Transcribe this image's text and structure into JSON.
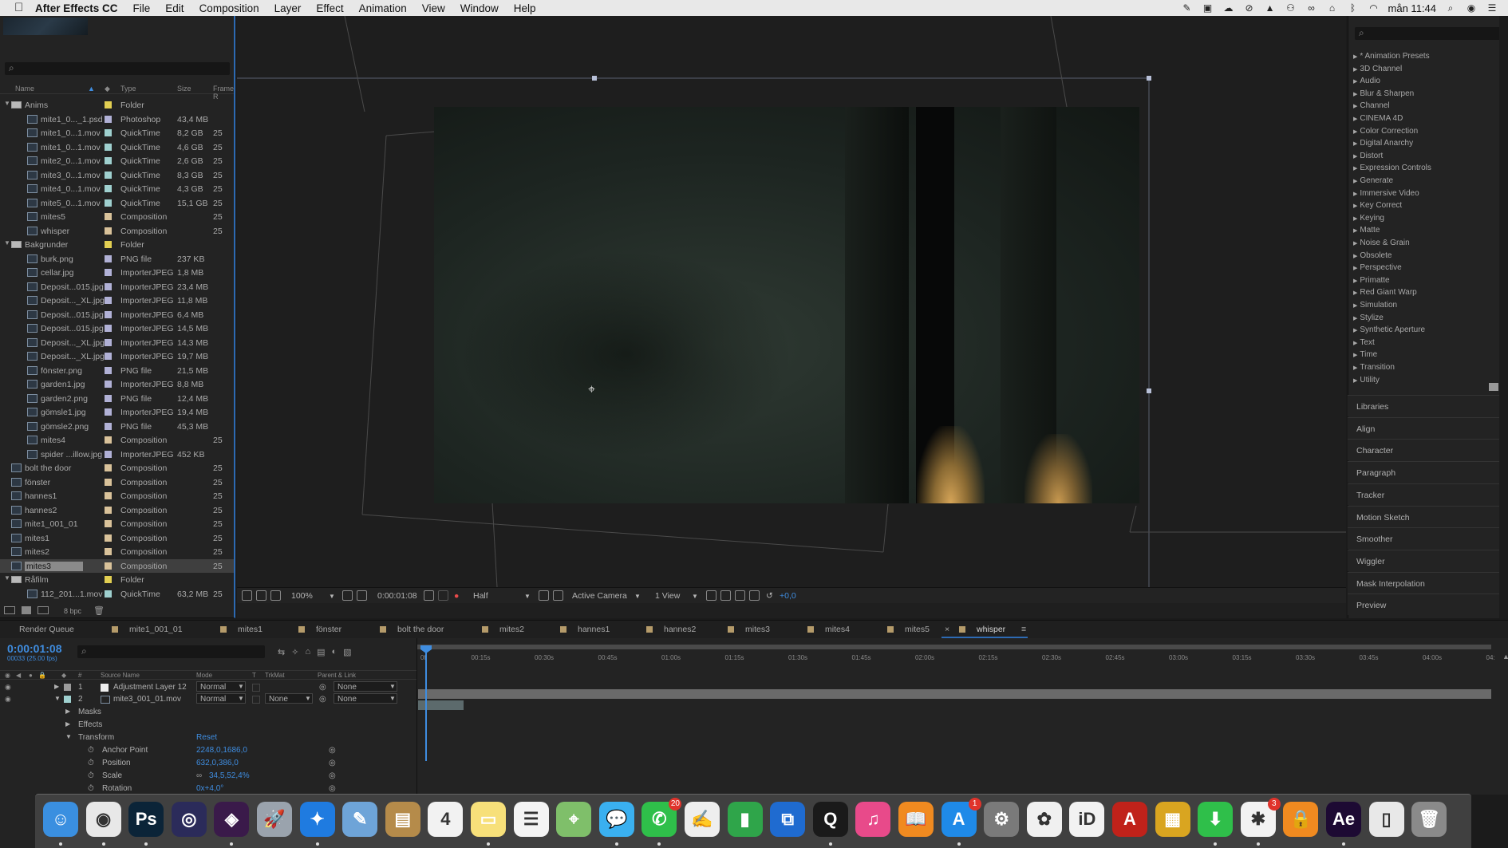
{
  "menubar": {
    "apple": "",
    "items": [
      "After Effects CC",
      "File",
      "Edit",
      "Composition",
      "Layer",
      "Effect",
      "Animation",
      "View",
      "Window",
      "Help"
    ],
    "clock": "mån 11:44"
  },
  "project": {
    "columns": {
      "name": "Name",
      "type": "Type",
      "size": "Size",
      "frame": "Frame R"
    },
    "rows": [
      {
        "indent": 0,
        "twirl": "▼",
        "name": "Anims",
        "type": "Folder",
        "size": "",
        "frame": "",
        "color": "#e2cf52",
        "kind": "folder"
      },
      {
        "indent": 1,
        "name": "mite1_0..._1.psd",
        "type": "Photoshop",
        "size": "43,4 MB",
        "frame": "",
        "color": "#b1b1d6",
        "kind": "file"
      },
      {
        "indent": 1,
        "name": "mite1_0...1.mov",
        "type": "QuickTime",
        "size": "8,2 GB",
        "frame": "25",
        "color": "#9fd0cf",
        "kind": "file"
      },
      {
        "indent": 1,
        "name": "mite1_0...1.mov",
        "type": "QuickTime",
        "size": "4,6 GB",
        "frame": "25",
        "color": "#9fd0cf",
        "kind": "file"
      },
      {
        "indent": 1,
        "name": "mite2_0...1.mov",
        "type": "QuickTime",
        "size": "2,6 GB",
        "frame": "25",
        "color": "#9fd0cf",
        "kind": "file"
      },
      {
        "indent": 1,
        "name": "mite3_0...1.mov",
        "type": "QuickTime",
        "size": "8,3 GB",
        "frame": "25",
        "color": "#9fd0cf",
        "kind": "file"
      },
      {
        "indent": 1,
        "name": "mite4_0...1.mov",
        "type": "QuickTime",
        "size": "4,3 GB",
        "frame": "25",
        "color": "#9fd0cf",
        "kind": "file"
      },
      {
        "indent": 1,
        "name": "mite5_0...1.mov",
        "type": "QuickTime",
        "size": "15,1 GB",
        "frame": "25",
        "color": "#9fd0cf",
        "kind": "file"
      },
      {
        "indent": 1,
        "name": "mites5",
        "type": "Composition",
        "size": "",
        "frame": "25",
        "color": "#d9c29a",
        "kind": "comp"
      },
      {
        "indent": 1,
        "name": "whisper",
        "type": "Composition",
        "size": "",
        "frame": "25",
        "color": "#d9c29a",
        "kind": "comp"
      },
      {
        "indent": 0,
        "twirl": "▼",
        "name": "Bakgrunder",
        "type": "Folder",
        "size": "",
        "frame": "",
        "color": "#e2cf52",
        "kind": "folder"
      },
      {
        "indent": 1,
        "name": "burk.png",
        "type": "PNG file",
        "size": "237 KB",
        "frame": "",
        "color": "#b1b1d6",
        "kind": "file"
      },
      {
        "indent": 1,
        "name": "cellar.jpg",
        "type": "ImporterJPEG",
        "size": "1,8 MB",
        "frame": "",
        "color": "#b1b1d6",
        "kind": "file"
      },
      {
        "indent": 1,
        "name": "Deposit...015.jpg",
        "type": "ImporterJPEG",
        "size": "23,4 MB",
        "frame": "",
        "color": "#b1b1d6",
        "kind": "file"
      },
      {
        "indent": 1,
        "name": "Deposit..._XL.jpg",
        "type": "ImporterJPEG",
        "size": "11,8 MB",
        "frame": "",
        "color": "#b1b1d6",
        "kind": "file"
      },
      {
        "indent": 1,
        "name": "Deposit...015.jpg",
        "type": "ImporterJPEG",
        "size": "6,4 MB",
        "frame": "",
        "color": "#b1b1d6",
        "kind": "file"
      },
      {
        "indent": 1,
        "name": "Deposit...015.jpg",
        "type": "ImporterJPEG",
        "size": "14,5 MB",
        "frame": "",
        "color": "#b1b1d6",
        "kind": "file"
      },
      {
        "indent": 1,
        "name": "Deposit..._XL.jpg",
        "type": "ImporterJPEG",
        "size": "14,3 MB",
        "frame": "",
        "color": "#b1b1d6",
        "kind": "file"
      },
      {
        "indent": 1,
        "name": "Deposit..._XL.jpg",
        "type": "ImporterJPEG",
        "size": "19,7 MB",
        "frame": "",
        "color": "#b1b1d6",
        "kind": "file"
      },
      {
        "indent": 1,
        "name": "fönster.png",
        "type": "PNG file",
        "size": "21,5 MB",
        "frame": "",
        "color": "#b1b1d6",
        "kind": "file"
      },
      {
        "indent": 1,
        "name": "garden1.jpg",
        "type": "ImporterJPEG",
        "size": "8,8 MB",
        "frame": "",
        "color": "#b1b1d6",
        "kind": "file"
      },
      {
        "indent": 1,
        "name": "garden2.png",
        "type": "PNG file",
        "size": "12,4 MB",
        "frame": "",
        "color": "#b1b1d6",
        "kind": "file"
      },
      {
        "indent": 1,
        "name": "gömsle1.jpg",
        "type": "ImporterJPEG",
        "size": "19,4 MB",
        "frame": "",
        "color": "#b1b1d6",
        "kind": "file"
      },
      {
        "indent": 1,
        "name": "gömsle2.png",
        "type": "PNG file",
        "size": "45,3 MB",
        "frame": "",
        "color": "#b1b1d6",
        "kind": "file"
      },
      {
        "indent": 1,
        "name": "mites4",
        "type": "Composition",
        "size": "",
        "frame": "25",
        "color": "#d9c29a",
        "kind": "comp"
      },
      {
        "indent": 1,
        "name": "spider ...illow.jpg",
        "type": "ImporterJPEG",
        "size": "452 KB",
        "frame": "",
        "color": "#b1b1d6",
        "kind": "file"
      },
      {
        "indent": 0,
        "name": "bolt the door",
        "type": "Composition",
        "size": "",
        "frame": "25",
        "color": "#d9c29a",
        "kind": "comp"
      },
      {
        "indent": 0,
        "name": "fönster",
        "type": "Composition",
        "size": "",
        "frame": "25",
        "color": "#d9c29a",
        "kind": "comp"
      },
      {
        "indent": 0,
        "name": "hannes1",
        "type": "Composition",
        "size": "",
        "frame": "25",
        "color": "#d9c29a",
        "kind": "comp"
      },
      {
        "indent": 0,
        "name": "hannes2",
        "type": "Composition",
        "size": "",
        "frame": "25",
        "color": "#d9c29a",
        "kind": "comp"
      },
      {
        "indent": 0,
        "name": "mite1_001_01",
        "type": "Composition",
        "size": "",
        "frame": "25",
        "color": "#d9c29a",
        "kind": "comp"
      },
      {
        "indent": 0,
        "name": "mites1",
        "type": "Composition",
        "size": "",
        "frame": "25",
        "color": "#d9c29a",
        "kind": "comp"
      },
      {
        "indent": 0,
        "name": "mites2",
        "type": "Composition",
        "size": "",
        "frame": "25",
        "color": "#d9c29a",
        "kind": "comp"
      },
      {
        "indent": 0,
        "name": "mites3",
        "type": "Composition",
        "size": "",
        "frame": "25",
        "color": "#d9c29a",
        "kind": "comp",
        "selected": true
      },
      {
        "indent": 0,
        "twirl": "▼",
        "name": "Råfilm",
        "type": "Folder",
        "size": "",
        "frame": "",
        "color": "#e2cf52",
        "kind": "folder"
      },
      {
        "indent": 1,
        "name": "112_201...1.mov",
        "type": "QuickTime",
        "size": "63,2 MB",
        "frame": "25",
        "color": "#9fd0cf",
        "kind": "file"
      }
    ],
    "footer_bpc": "8 bpc"
  },
  "viewer": {
    "zoom": "100%",
    "timecode": "0:00:01:08",
    "resolution": "Half",
    "camera": "Active Camera",
    "views": "1 View",
    "exposure": "+0,0"
  },
  "effects": {
    "categories": [
      "* Animation Presets",
      "3D Channel",
      "Audio",
      "Blur & Sharpen",
      "Channel",
      "CINEMA 4D",
      "Color Correction",
      "Digital Anarchy",
      "Distort",
      "Expression Controls",
      "Generate",
      "Immersive Video",
      "Key Correct",
      "Keying",
      "Matte",
      "Noise & Grain",
      "Obsolete",
      "Perspective",
      "Primatte",
      "Red Giant Warp",
      "Simulation",
      "Stylize",
      "Synthetic Aperture",
      "Text",
      "Time",
      "Transition",
      "Utility"
    ],
    "panels": [
      "Libraries",
      "Align",
      "Character",
      "Paragraph",
      "Tracker",
      "Motion Sketch",
      "Smoother",
      "Wiggler",
      "Mask Interpolation",
      "Preview"
    ]
  },
  "timeline": {
    "tabs": [
      "Render Queue",
      "mite1_001_01",
      "mites1",
      "fönster",
      "bolt the door",
      "mites2",
      "hannes1",
      "hannes2",
      "mites3",
      "mites4",
      "mites5",
      "whisper"
    ],
    "active_tab": "whisper",
    "current_time": "0:00:01:08",
    "fps": "00033 (25.00 fps)",
    "columns": {
      "num": "#",
      "source": "Source Name",
      "mode": "Mode",
      "t": "T",
      "trkmat": "TrkMat",
      "parent": "Parent & Link"
    },
    "layers": [
      {
        "num": "1",
        "name": "Adjustment Layer 12",
        "mode": "Normal",
        "trkmat": "",
        "parent": "None"
      },
      {
        "num": "2",
        "name": "mite3_001_01.mov",
        "mode": "Normal",
        "trkmat": "None",
        "parent": "None"
      }
    ],
    "props": {
      "masks": "Masks",
      "effects": "Effects",
      "transform": "Transform",
      "reset": "Reset",
      "anchor_label": "Anchor Point",
      "anchor_value": "2248,0,1686,0",
      "position_label": "Position",
      "position_value": "632,0,386,0",
      "scale_label": "Scale",
      "scale_value": "34,5,52,4%",
      "rotation_label": "Rotation",
      "rotation_value": "0x+4,0°"
    },
    "ruler": [
      "0f",
      "00:15s",
      "00:30s",
      "00:45s",
      "01:00s",
      "01:15s",
      "01:30s",
      "01:45s",
      "02:00s",
      "02:15s",
      "02:30s",
      "02:45s",
      "03:00s",
      "03:15s",
      "03:30s",
      "03:45s",
      "04:00s",
      "04:"
    ]
  },
  "dock": {
    "apps": [
      {
        "name": "finder",
        "label": "☺",
        "color": "#3a8fe0"
      },
      {
        "name": "chrome",
        "label": "◉",
        "color": "#e8e8e8"
      },
      {
        "name": "photoshop",
        "label": "Ps",
        "color": "#0b2438"
      },
      {
        "name": "siri",
        "label": "◎",
        "color": "#2b2b5a"
      },
      {
        "name": "motion",
        "label": "◈",
        "color": "#3a1a4a"
      },
      {
        "name": "launchpad",
        "label": "🚀",
        "color": "#9aa3ad"
      },
      {
        "name": "safari",
        "label": "✦",
        "color": "#1f7be0"
      },
      {
        "name": "preview",
        "label": "✎",
        "color": "#6ea4d8"
      },
      {
        "name": "notes-app",
        "label": "▤",
        "color": "#b58b4a"
      },
      {
        "name": "calendar",
        "label": "4",
        "color": "#f2f2f2"
      },
      {
        "name": "notes",
        "label": "▭",
        "color": "#f7e07a"
      },
      {
        "name": "reminders",
        "label": "☰",
        "color": "#f4f4f4"
      },
      {
        "name": "maps",
        "label": "⌖",
        "color": "#7fbf6a"
      },
      {
        "name": "messages",
        "label": "💬",
        "color": "#3ab0f0"
      },
      {
        "name": "facetime",
        "label": "✆",
        "color": "#2fbf4a",
        "badge": "20"
      },
      {
        "name": "textedit",
        "label": "✍",
        "color": "#eeeeee"
      },
      {
        "name": "numbers",
        "label": "▮",
        "color": "#2fa54a"
      },
      {
        "name": "keynote",
        "label": "⧉",
        "color": "#1f6bd0"
      },
      {
        "name": "quicktime",
        "label": "Q",
        "color": "#1a1a1a"
      },
      {
        "name": "itunes",
        "label": "♫",
        "color": "#e84a8a"
      },
      {
        "name": "ibooks",
        "label": "📖",
        "color": "#f08a20"
      },
      {
        "name": "app-store",
        "label": "A",
        "color": "#1f8ae8",
        "badge": "1"
      },
      {
        "name": "system-preferences",
        "label": "⚙",
        "color": "#7a7a7a"
      },
      {
        "name": "photos",
        "label": "✿",
        "color": "#f0f0f0"
      },
      {
        "name": "bankid",
        "label": "iD",
        "color": "#f2f2f2"
      },
      {
        "name": "acrobat",
        "label": "A",
        "color": "#c0221a"
      },
      {
        "name": "archive",
        "label": "▦",
        "color": "#d9a520"
      },
      {
        "name": "downloader",
        "label": "⬇",
        "color": "#2fbf4a"
      },
      {
        "name": "podcast-app",
        "label": "✱",
        "color": "#f2f2f2",
        "badge": "3"
      },
      {
        "name": "vpn-lock",
        "label": "🔒",
        "color": "#f08a20"
      },
      {
        "name": "after-effects",
        "label": "Ae",
        "color": "#1d0a33"
      },
      {
        "name": "document",
        "label": "▯",
        "color": "#e8e8e8"
      },
      {
        "name": "trash",
        "label": "🗑",
        "color": "#8a8a8a"
      }
    ]
  }
}
